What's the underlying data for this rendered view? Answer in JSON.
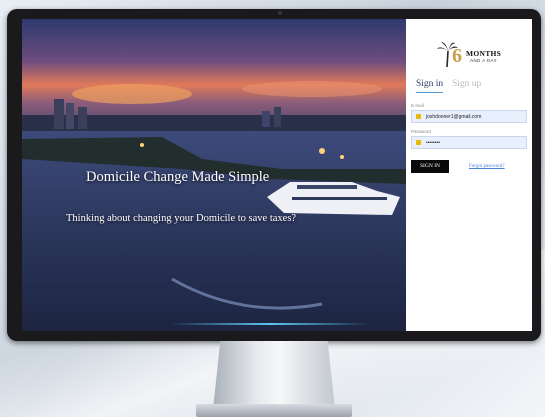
{
  "hero": {
    "headline": "Domicile Change Made Simple",
    "subline": "Thinking about changing your Domicile to save taxes?"
  },
  "brand": {
    "logo_numeral": "6",
    "logo_word": "MONTHS",
    "logo_tagline": "AND A DAY"
  },
  "auth": {
    "tabs": [
      {
        "label": "Sign in",
        "active": true
      },
      {
        "label": "Sign up",
        "active": false
      }
    ],
    "email_label": "E-mail",
    "email_value": "joshdonner1@gmail.com",
    "password_label": "Password",
    "password_value": "••••••••",
    "submit_label": "SIGN IN",
    "forgot_label": "Forgot password?"
  },
  "colors": {
    "accent_tab_underline": "#5b9bd5",
    "link": "#4a86d8",
    "button": "#0a0a0a",
    "field_fill": "#e8f0fe",
    "logo_gold": "#c6a14a"
  },
  "icons": {
    "email_field": "key-icon",
    "password_field": "key-icon",
    "logo": "palm-tree-icon"
  }
}
